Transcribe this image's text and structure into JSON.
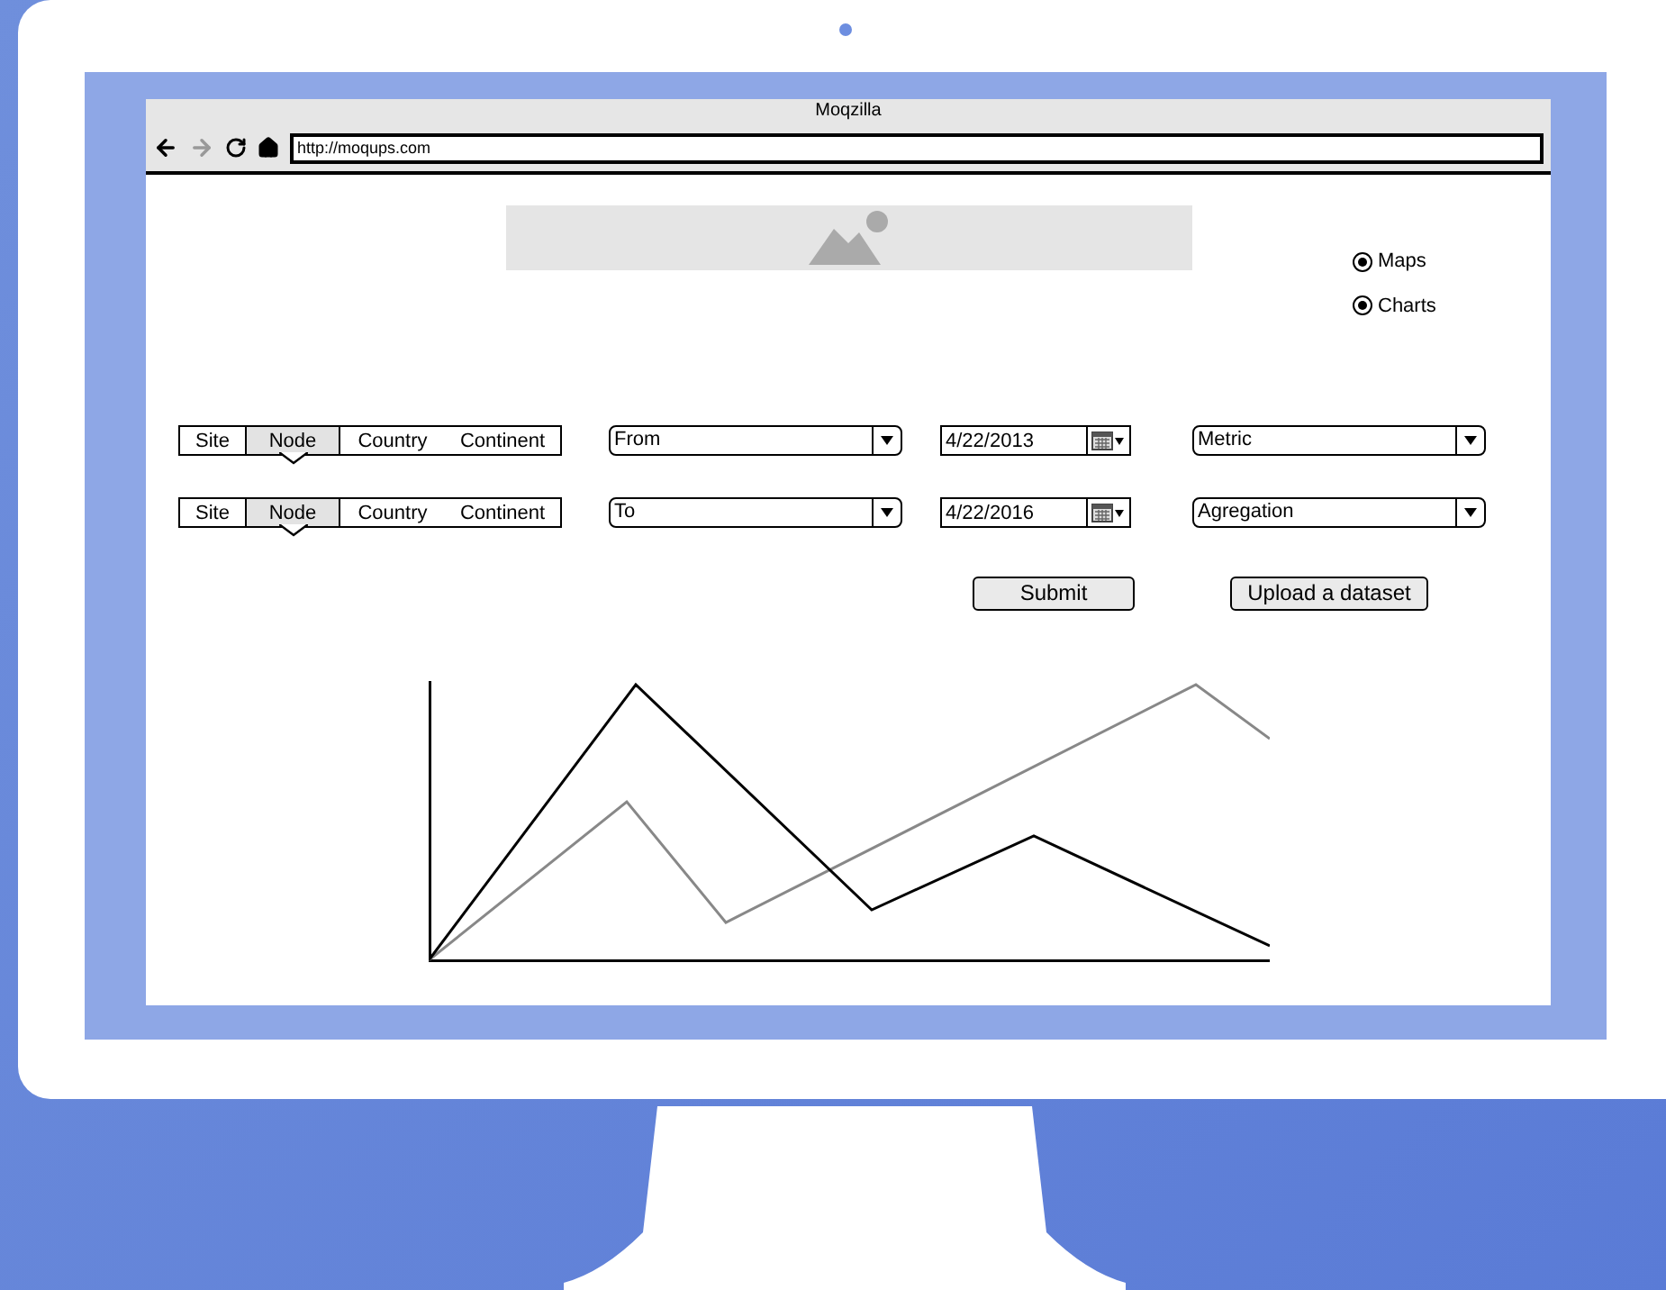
{
  "browser": {
    "title": "Moqzilla",
    "url": "http://moqups.com"
  },
  "view_options": [
    {
      "label": "Maps",
      "selected": true
    },
    {
      "label": "Charts",
      "selected": true
    }
  ],
  "filter_rows": [
    {
      "levels": [
        {
          "label": "Site",
          "selected": false
        },
        {
          "label": "Node",
          "selected": true
        },
        {
          "label": "Country",
          "selected": false
        },
        {
          "label": "Continent",
          "selected": false
        }
      ],
      "range_select": "From",
      "date": "4/22/2013",
      "option_select": "Metric"
    },
    {
      "levels": [
        {
          "label": "Site",
          "selected": false
        },
        {
          "label": "Node",
          "selected": true
        },
        {
          "label": "Country",
          "selected": false
        },
        {
          "label": "Continent",
          "selected": false
        }
      ],
      "range_select": "To",
      "date": "4/22/2016",
      "option_select": "Agregation"
    }
  ],
  "buttons": [
    "Submit",
    "Upload a dataset"
  ]
}
